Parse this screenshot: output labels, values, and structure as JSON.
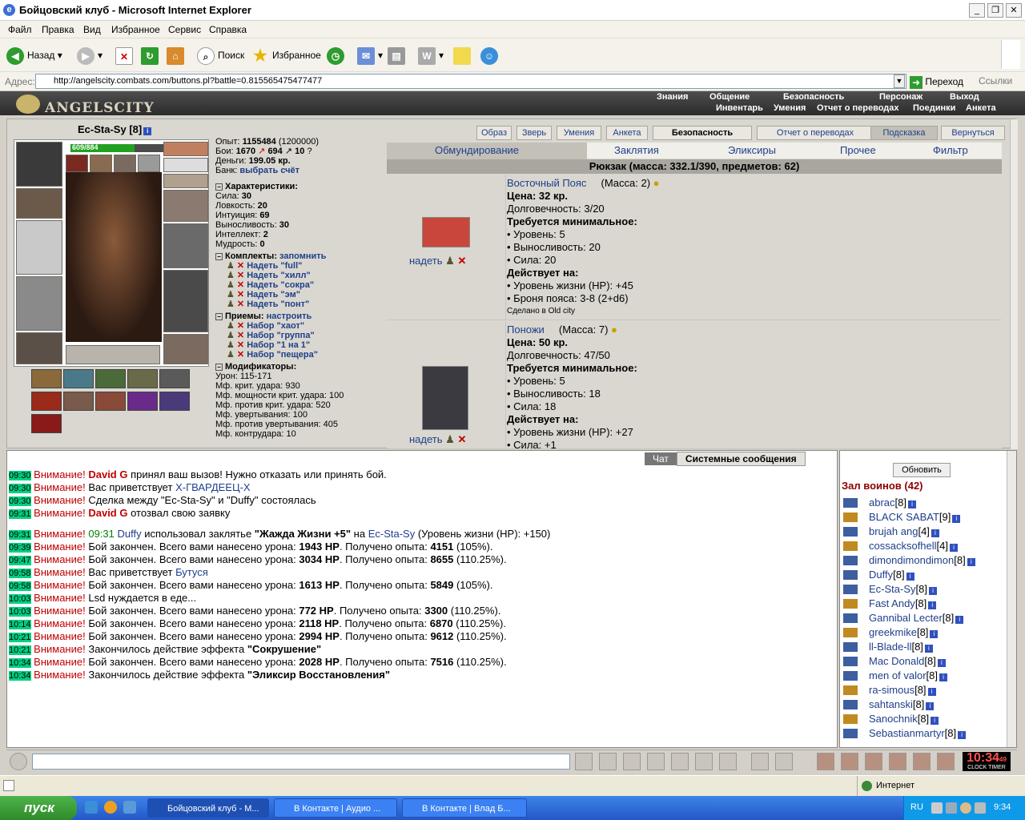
{
  "window": {
    "title": "Бойцовский клуб - Microsoft Internet Explorer"
  },
  "menu": [
    "Файл",
    "Правка",
    "Вид",
    "Избранное",
    "Сервис",
    "Справка"
  ],
  "toolbar": {
    "back": "Назад",
    "search": "Поиск",
    "favorites": "Избранное"
  },
  "address": {
    "label": "Адрес:",
    "url": "http://angelscity.combats.com/buttons.pl?battle=0.815565475477477",
    "go": "Переход",
    "links": "Ссылки"
  },
  "site": {
    "logo": "ANGELSCITY",
    "nav_top": [
      "Знания",
      "Общение",
      "Безопасность",
      "Персонаж",
      "Выход"
    ],
    "nav_bottom": [
      "Инвентарь",
      "Умения",
      "Отчет о переводах",
      "Поединки",
      "Анкета"
    ]
  },
  "character": {
    "name": "Ec-Sta-Sy",
    "level": "[8]",
    "hp_text": "609/884",
    "hp_fraction": 0.689,
    "exp": "Опыт:",
    "exp_value": "1155484",
    "exp_next": "(1200000)",
    "fights": "Бои:",
    "wins": "1670",
    "losses": "694",
    "draws": "10",
    "money": "Деньги:",
    "money_value": "199.05 кр.",
    "bank": "Банк:",
    "bank_link": "выбрать счёт"
  },
  "stats_section": {
    "title": "Характеристики:",
    "items": [
      {
        "label": "Сила:",
        "value": "30"
      },
      {
        "label": "Ловкость:",
        "value": "20"
      },
      {
        "label": "Интуиция:",
        "value": "69"
      },
      {
        "label": "Выносливость:",
        "value": "30"
      },
      {
        "label": "Интеллект:",
        "value": "2"
      },
      {
        "label": "Мудрость:",
        "value": "0"
      }
    ]
  },
  "sets_section": {
    "title": "Комплекты:",
    "action": "запомнить",
    "items": [
      "Надеть \"full\"",
      "Надеть \"хилл\"",
      "Надеть \"сокра\"",
      "Надеть \"эм\"",
      "Надеть \"понт\""
    ]
  },
  "tricks_section": {
    "title": "Приемы:",
    "action": "настроить",
    "items": [
      "Набор \"хаот\"",
      "Набор \"группа\"",
      "Набор \"1 на 1\"",
      "Набор \"пещера\""
    ]
  },
  "mods_section": {
    "title": "Модификаторы:",
    "items": [
      "Урон: 115-171",
      "Мф. крит. удара: 930",
      "Мф. мощности крит. удара: 100",
      "Мф. против крит. удара: 520",
      "Мф. увертывания: 100",
      "Мф. против увертывания: 405",
      "Мф. контрудара: 10"
    ]
  },
  "page_buttons": [
    "Образ",
    "Зверь",
    "Умения",
    "Анкета",
    "Безопасность",
    "Отчет о переводах",
    "Подсказка",
    "Вернуться"
  ],
  "inv_tabs": [
    "Обмундирование",
    "Заклятия",
    "Эликсиры",
    "Прочее",
    "Фильтр"
  ],
  "backpack": "Рюкзак (масса: 332.1/390, предметов: 62)",
  "items": [
    {
      "name": "Восточный Пояс",
      "mass": "(Масса: 2)",
      "price": "Цена: 32 кр.",
      "durability": "Долговечность: 3/20",
      "req_title": "Требуется минимальное:",
      "reqs": [
        "• Уровень: 5",
        "• Выносливость: 20",
        "• Сила: 20"
      ],
      "eff_title": "Действует на:",
      "effects": [
        "• Уровень жизни (HP): +45",
        "• Броня пояса: 3-8 (2+d6)"
      ],
      "made": "Сделано в Old city",
      "equip": "надеть"
    },
    {
      "name": "Поножи",
      "mass": "(Масса: 7)",
      "price": "Цена: 50 кр.",
      "durability": "Долговечность: 47/50",
      "req_title": "Требуется минимальное:",
      "reqs": [
        "• Уровень: 5",
        "• Выносливость: 18",
        "• Сила: 18"
      ],
      "eff_title": "Действует на:",
      "effects": [
        "• Уровень жизни (HP): +27",
        "• Сила: +1"
      ],
      "equip": "надеть"
    }
  ],
  "chat": {
    "tabs": [
      "Чат",
      "Системные сообщения"
    ],
    "lines": [
      {
        "t": "09:30",
        "w": "Внимание!",
        "parts": [
          {
            "x": "David G",
            "c": "red"
          },
          {
            "x": " принял ваш вызов! Нужно отказать или принять бой."
          }
        ]
      },
      {
        "t": "09:30",
        "w": "Внимание!",
        "parts": [
          {
            "x": "Вас приветствует "
          },
          {
            "x": "Х-ГВАРДЕЕЦ-Х",
            "c": "nick"
          }
        ]
      },
      {
        "t": "09:30",
        "w": "Внимание!",
        "parts": [
          {
            "x": "Сделка между \"Ec-Sta-Sy\" и \"Duffy\" состоялась"
          }
        ]
      },
      {
        "t": "09:31",
        "w": "Внимание!",
        "parts": [
          {
            "x": "David G",
            "c": "red"
          },
          {
            "x": " отозвал свою заявку"
          }
        ]
      },
      {
        "t": "09:31",
        "w": "Внимание!",
        "gap": true,
        "parts": [
          {
            "x": "09:31",
            "c": "green"
          },
          {
            "x": "   "
          },
          {
            "x": "Duffy",
            "c": "nick"
          },
          {
            "x": " использовал заклятье "
          },
          {
            "x": "\"Жажда Жизни +5\"",
            "c": "bold"
          },
          {
            "x": " на "
          },
          {
            "x": "Ec-Sta-Sy",
            "c": "nick"
          },
          {
            "x": " (Уровень жизни (HP): +150)"
          }
        ]
      },
      {
        "t": "09:39",
        "w": "Внимание!",
        "parts": [
          {
            "x": "Бой закончен. Всего вами нанесено урона: "
          },
          {
            "x": "1943 HP",
            "c": "bold"
          },
          {
            "x": ". Получено опыта: "
          },
          {
            "x": "4151",
            "c": "bold"
          },
          {
            "x": " (105%)."
          }
        ]
      },
      {
        "t": "09:47",
        "w": "Внимание!",
        "parts": [
          {
            "x": "Бой закончен. Всего вами нанесено урона: "
          },
          {
            "x": "3034 HP",
            "c": "bold"
          },
          {
            "x": ". Получено опыта: "
          },
          {
            "x": "8655",
            "c": "bold"
          },
          {
            "x": " (110.25%)."
          }
        ]
      },
      {
        "t": "09:58",
        "w": "Внимание!",
        "parts": [
          {
            "x": "Вас приветствует "
          },
          {
            "x": "Бутуся",
            "c": "nick"
          }
        ]
      },
      {
        "t": "09:58",
        "w": "Внимание!",
        "parts": [
          {
            "x": "Бой закончен. Всего вами нанесено урона: "
          },
          {
            "x": "1613 HP",
            "c": "bold"
          },
          {
            "x": ". Получено опыта: "
          },
          {
            "x": "5849",
            "c": "bold"
          },
          {
            "x": " (105%)."
          }
        ]
      },
      {
        "t": "10:03",
        "w": "Внимание!",
        "parts": [
          {
            "x": "Lsd нуждается в еде..."
          }
        ]
      },
      {
        "t": "10:03",
        "w": "Внимание!",
        "parts": [
          {
            "x": "Бой закончен. Всего вами нанесено урона: "
          },
          {
            "x": "772 HP",
            "c": "bold"
          },
          {
            "x": ". Получено опыта: "
          },
          {
            "x": "3300",
            "c": "bold"
          },
          {
            "x": " (110.25%)."
          }
        ]
      },
      {
        "t": "10:14",
        "w": "Внимание!",
        "parts": [
          {
            "x": "Бой закончен. Всего вами нанесено урона: "
          },
          {
            "x": "2118 HP",
            "c": "bold"
          },
          {
            "x": ". Получено опыта: "
          },
          {
            "x": "6870",
            "c": "bold"
          },
          {
            "x": " (110.25%)."
          }
        ]
      },
      {
        "t": "10:21",
        "w": "Внимание!",
        "parts": [
          {
            "x": "Бой закончен. Всего вами нанесено урона: "
          },
          {
            "x": "2994 HP",
            "c": "bold"
          },
          {
            "x": ". Получено опыта: "
          },
          {
            "x": "9612",
            "c": "bold"
          },
          {
            "x": " (110.25%)."
          }
        ]
      },
      {
        "t": "10:21",
        "w": "Внимание!",
        "parts": [
          {
            "x": "Закончилось действие эффекта "
          },
          {
            "x": "\"Сокрушение\"",
            "c": "bold"
          }
        ]
      },
      {
        "t": "10:34",
        "w": "Внимание!",
        "parts": [
          {
            "x": "Бой закончен. Всего вами нанесено урона: "
          },
          {
            "x": "2028 HP",
            "c": "bold"
          },
          {
            "x": ". Получено опыта: "
          },
          {
            "x": "7516",
            "c": "bold"
          },
          {
            "x": " (110.25%)."
          }
        ]
      },
      {
        "t": "10:34",
        "w": "Внимание!",
        "parts": [
          {
            "x": "Закончилось действие эффекта "
          },
          {
            "x": "\"Эликсир Восстановления\"",
            "c": "bold"
          }
        ]
      }
    ]
  },
  "players": {
    "refresh": "Обновить",
    "hall": "Зал воинов (42)",
    "list": [
      {
        "n": "abrac",
        "l": "[8]"
      },
      {
        "n": "BLACK SABAT",
        "l": "[9]"
      },
      {
        "n": "brujah ang",
        "l": "[4]"
      },
      {
        "n": "cossacksofhell",
        "l": "[4]"
      },
      {
        "n": "dimondimondimon",
        "l": "[8]"
      },
      {
        "n": "Duffy",
        "l": "[8]"
      },
      {
        "n": "Ec-Sta-Sy",
        "l": "[8]"
      },
      {
        "n": "Fast Andy",
        "l": "[8]"
      },
      {
        "n": "Gannibal Lecter",
        "l": "[8]"
      },
      {
        "n": "greekmike",
        "l": "[8]"
      },
      {
        "n": "ll-Blade-ll",
        "l": "[8]"
      },
      {
        "n": "Mac Donald",
        "l": "[8]"
      },
      {
        "n": "men of valor",
        "l": "[8]"
      },
      {
        "n": "ra-simous",
        "l": "[8]"
      },
      {
        "n": "sahtanski",
        "l": "[8]"
      },
      {
        "n": "Sanochnik",
        "l": "[8]"
      },
      {
        "n": "Sebastianmartyr",
        "l": "[8]"
      }
    ]
  },
  "clock": {
    "time": "10:34",
    "sec": "49",
    "labels": "CLOCK TIMER"
  },
  "status": {
    "zone": "Интернет"
  },
  "taskbar": {
    "start": "пуск",
    "tasks": [
      "Бойцовский клуб - M...",
      "В Контакте | Аудио ...",
      "В Контакте | Влад Б..."
    ],
    "lang": "RU",
    "time": "9:34"
  }
}
